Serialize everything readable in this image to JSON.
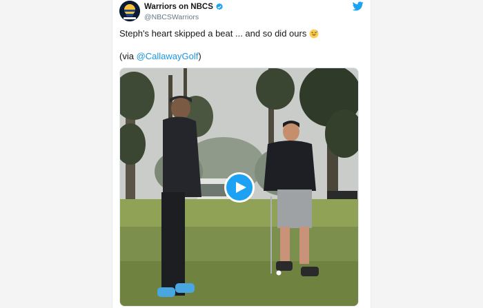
{
  "tweet": {
    "display_name": "Warriors on NBCS",
    "handle": "@NBCSWarriors",
    "text": "Steph's heart skipped a beat ... and so did ours",
    "emoji": "sweat-smile-emoji",
    "via_prefix": "(via ",
    "via_mention": "@CallawayGolf",
    "via_suffix": ")"
  },
  "icons": {
    "brand": "twitter-bird-icon",
    "verified": "verified-badge-icon",
    "play": "play-icon"
  },
  "colors": {
    "twitter_blue": "#1da1f2",
    "link": "#1b95e0",
    "text": "#14171a",
    "secondary_text": "#657786"
  }
}
